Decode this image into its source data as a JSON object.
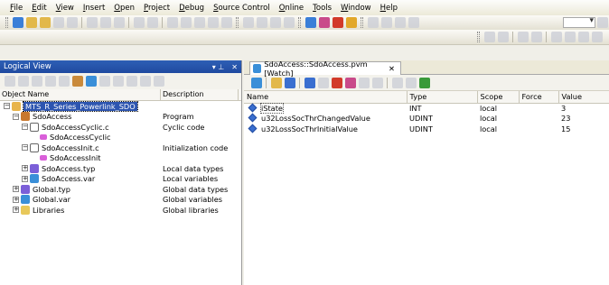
{
  "menu": [
    "File",
    "Edit",
    "View",
    "Insert",
    "Open",
    "Project",
    "Debug",
    "Source Control",
    "Online",
    "Tools",
    "Window",
    "Help"
  ],
  "left_pane": {
    "title": "Logical View",
    "pin": "▾ ⊥",
    "close": "✕",
    "col_name": "Object Name",
    "col_desc": "Description",
    "tree": [
      {
        "label": "MTS_R_Series_Powerlink_SDO",
        "desc": "",
        "icon": "project-icon",
        "color": "#e8b44a"
      },
      {
        "label": "SdoAccess",
        "desc": "Program",
        "icon": "program-icon",
        "color": "#c8782e"
      },
      {
        "label": "SdoAccessCyclic.c",
        "desc": "Cyclic code",
        "icon": "c-file-icon",
        "color": "#ffffff"
      },
      {
        "label": "SdoAccessCyclic",
        "desc": "",
        "icon": "function-icon",
        "color": "#d95fd9"
      },
      {
        "label": "SdoAccessInit.c",
        "desc": "Initialization code",
        "icon": "c-file-icon",
        "color": "#ffffff"
      },
      {
        "label": "SdoAccessInit",
        "desc": "",
        "icon": "function-icon",
        "color": "#d95fd9"
      },
      {
        "label": "SdoAccess.typ",
        "desc": "Local data types",
        "icon": "datatype-icon",
        "color": "#7b5fd8"
      },
      {
        "label": "SdoAccess.var",
        "desc": "Local variables",
        "icon": "variable-icon",
        "color": "#3a8fd8"
      },
      {
        "label": "Global.typ",
        "desc": "Global data types",
        "icon": "datatype-icon",
        "color": "#7b5fd8"
      },
      {
        "label": "Global.var",
        "desc": "Global variables",
        "icon": "variable-icon",
        "color": "#3a8fd8"
      },
      {
        "label": "Libraries",
        "desc": "Global libraries",
        "icon": "folder-icon",
        "color": "#e8c85a"
      }
    ]
  },
  "watch": {
    "tab_label": "SdoAccess::SdoAccess.pvm [Watch]",
    "tab_close": "✕",
    "columns": [
      "Name",
      "Type",
      "Scope",
      "Force",
      "Value"
    ],
    "rows": [
      {
        "name": "iState",
        "type": "INT",
        "scope": "local",
        "force": "",
        "value": "3"
      },
      {
        "name": "u32LossSocThrChangedValue",
        "type": "UDINT",
        "scope": "local",
        "force": "",
        "value": "23"
      },
      {
        "name": "u32LossSocThrInitialValue",
        "type": "UDINT",
        "scope": "local",
        "force": "",
        "value": "15"
      }
    ]
  },
  "colors": {
    "accent": "#2d55b0",
    "pane_title": "#2e5fb5"
  }
}
